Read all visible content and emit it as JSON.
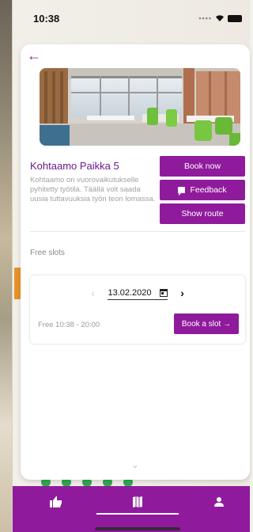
{
  "status_bar": {
    "time": "10:38"
  },
  "place": {
    "title": "Kohtaamo Paikka 5",
    "description": "Kohtaamo on vuorovaikutukselle pyhitetty työtila. Täällä voit saada uusia tuttavuuksia työn teon lomassa."
  },
  "actions": {
    "book_now": "Book now",
    "feedback": "Feedback",
    "show_route": "Show route"
  },
  "slots": {
    "label": "Free slots",
    "date": "13.02.2020",
    "prev_symbol": "‹",
    "next_symbol": "›",
    "free_time": "Free 10:38 - 20:00",
    "book_slot": "Book a slot →"
  },
  "nav": {
    "items": [
      "like-icon",
      "map-icon",
      "user-icon"
    ],
    "active": "map-icon"
  },
  "colors": {
    "accent": "#8f1b9c",
    "title": "#6b1a8a"
  }
}
